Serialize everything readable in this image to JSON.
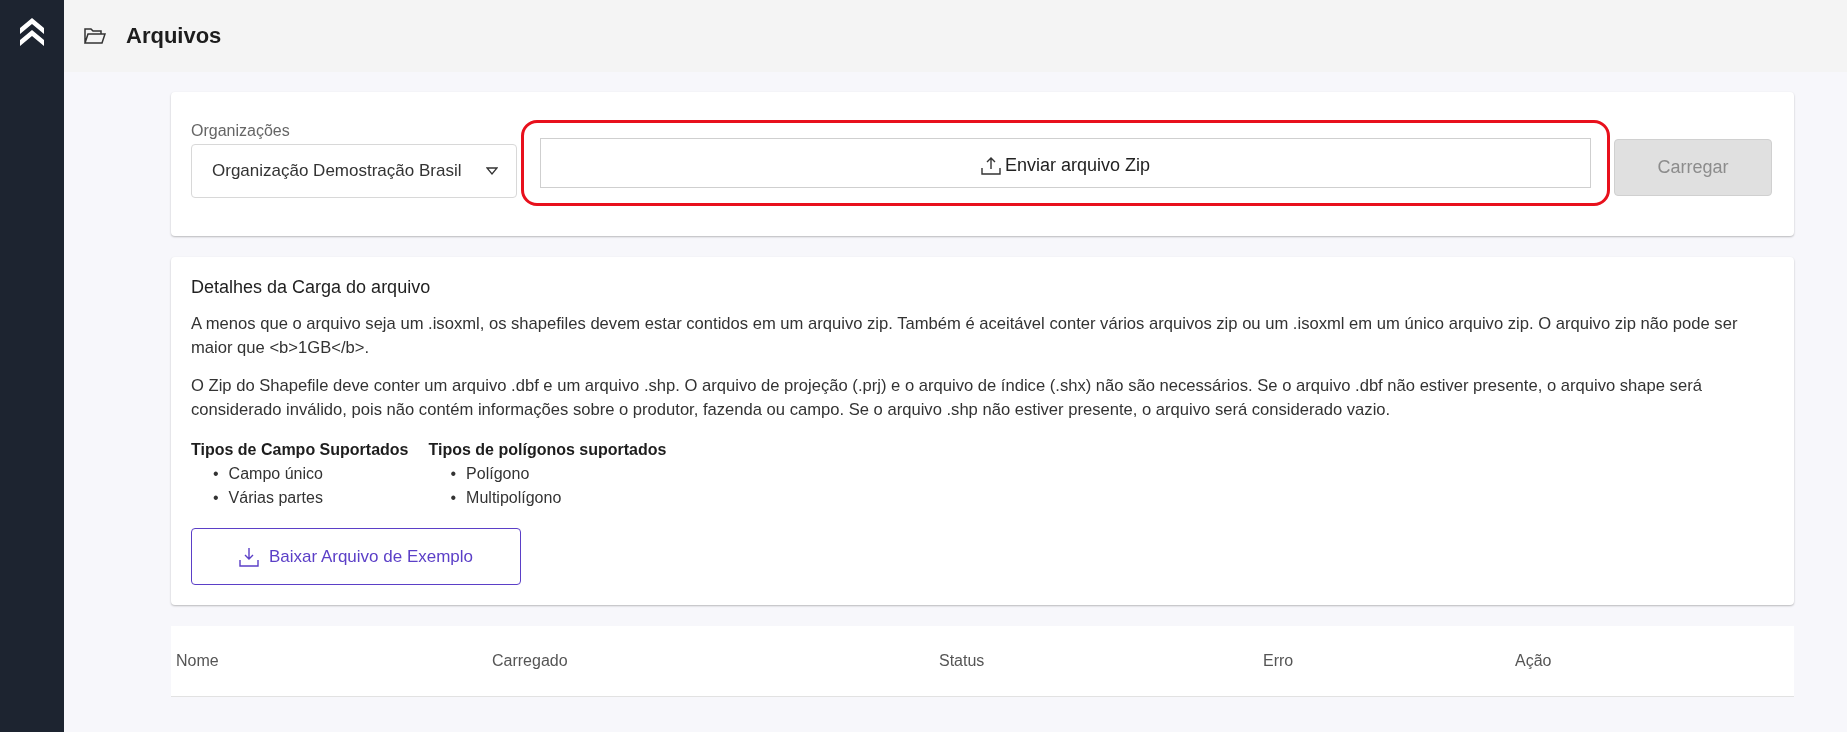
{
  "header": {
    "title": "Arquivos"
  },
  "upload": {
    "organization_label": "Organizações",
    "organization_value": "Organização Demostração Brasil",
    "upload_button": "Enviar arquivo Zip",
    "upload_highlighted": true,
    "submit_button": "Carregar",
    "submit_disabled": true
  },
  "details": {
    "title": "Detalhes da Carga do arquivo",
    "paragraphs": [
      "A menos que o arquivo seja um .isoxml, os shapefiles devem estar contidos em um arquivo zip. Também é aceitável conter vários arquivos zip ou um .isoxml em um único arquivo zip. O arquivo zip não pode ser maior que <b>1GB</b>.",
      "O Zip do Shapefile deve conter um arquivo .dbf e um arquivo .shp. O arquivo de projeção (.prj) e o arquivo de índice (.shx) não são necessários. Se o arquivo .dbf não estiver presente, o arquivo shape será considerado inválido, pois não contém informações sobre o produtor, fazenda ou campo. Se o arquivo .shp não estiver presente, o arquivo será considerado vazio."
    ],
    "lists": [
      {
        "title": "Tipos de Campo Suportados",
        "items": [
          {
            "bullet": "•",
            "text": "Campo único"
          },
          {
            "bullet": "•",
            "text": "Várias partes"
          }
        ]
      },
      {
        "title": "Tipos de polígonos suportados",
        "items": [
          {
            "bullet": "•",
            "text": "Polígono"
          },
          {
            "bullet": "•",
            "text": "Multipolígono"
          }
        ]
      }
    ],
    "download_button": "Baixar Arquivo de Exemplo"
  },
  "table": {
    "columns": [
      "Nome",
      "Carregado",
      "Status",
      "Erro",
      "Ação"
    ]
  }
}
